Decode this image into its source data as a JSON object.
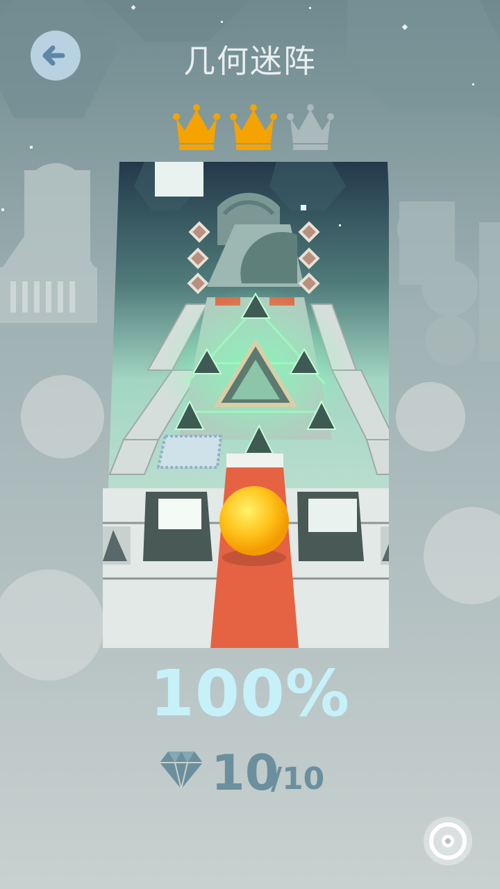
{
  "header": {
    "title": "几何迷阵",
    "back_icon": "arrow-left-icon"
  },
  "level": {
    "crowns_earned": 2,
    "crowns_total": 3,
    "progress": "100%",
    "gems_collected": "10",
    "gems_total": "/10"
  },
  "colors": {
    "crown_gold": "#f5a300",
    "crown_empty": "#b7c4c7",
    "progress_text": "#c6f1f9",
    "gem_text": "#6b8f9d",
    "back_button_bg": "#b8d2e2",
    "back_arrow": "#5d86a8",
    "ball": "#ffcc1a",
    "track_red": "#e56342"
  },
  "footer": {
    "music_icon": "vinyl-disc-icon"
  }
}
